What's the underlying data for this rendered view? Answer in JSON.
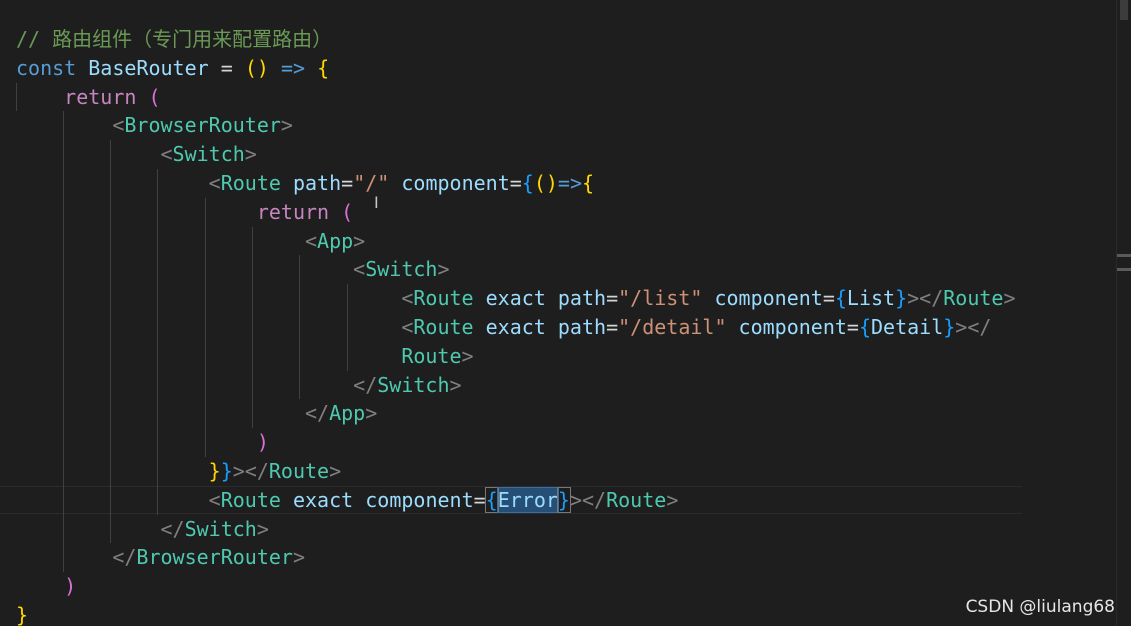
{
  "editor": {
    "theme_colors": {
      "background": "#1e1e1e",
      "comment": "#6a9955",
      "keyword": "#569cd6",
      "variable": "#9cdcfe",
      "tag": "#4ec9b0",
      "string": "#ce9178",
      "selection": "#264f78"
    },
    "lines": [
      "// 路由组件（专门用来配置路由）",
      "const BaseRouter = () => {",
      "    return (",
      "        <BrowserRouter>",
      "            <Switch>",
      "                <Route path=\"/\" component={()=>{",
      "                    return (",
      "                        <App>",
      "                            <Switch>",
      "                                <Route exact path=\"/list\" component={List}></Route>",
      "                                <Route exact path=\"/detail\" component={Detail}></",
      "                                Route>",
      "                            </Switch>",
      "                        </App>",
      "                    )",
      "                }}></Route>",
      "                <Route exact component={Error}></Route>",
      "            </Switch>",
      "        </BrowserRouter>",
      "    )",
      "}"
    ],
    "selected_token": "Error"
  },
  "watermark": "CSDN @liulang68"
}
